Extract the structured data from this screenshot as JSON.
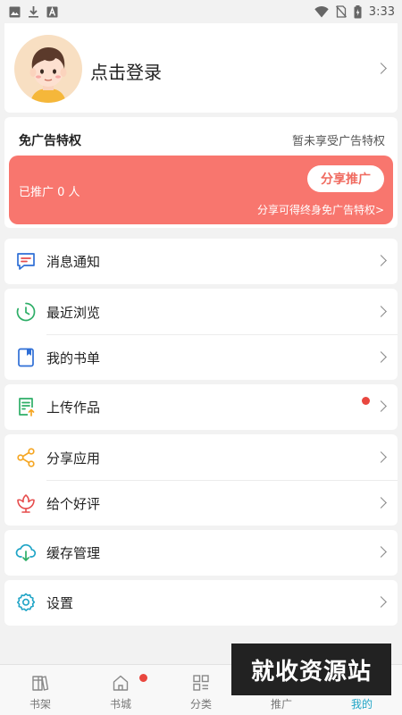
{
  "status_bar": {
    "time": "3:33",
    "icons": [
      "image-icon",
      "download-icon",
      "a-icon",
      "wifi-icon",
      "no-sim-icon",
      "battery-icon"
    ]
  },
  "profile": {
    "login_label": "点击登录"
  },
  "ad_privilege": {
    "title": "免广告特权",
    "status": "暂未享受广告特权",
    "promoted_count": "已推广 0 人",
    "share_button": "分享推广",
    "share_note": "分享可得终身免广告特权>"
  },
  "menu": {
    "messages": "消息通知",
    "recent": "最近浏览",
    "booklist": "我的书单",
    "upload": "上传作品",
    "share_app": "分享应用",
    "rate": "给个好评",
    "cache": "缓存管理",
    "settings": "设置"
  },
  "tabs": [
    {
      "label": "书架",
      "icon": "bookshelf-icon"
    },
    {
      "label": "书城",
      "icon": "home-icon",
      "badge": true
    },
    {
      "label": "分类",
      "icon": "grid-icon"
    },
    {
      "label": "推广",
      "icon": "promote-icon"
    },
    {
      "label": "我的",
      "icon": "profile-icon",
      "active": true
    }
  ],
  "watermark": "就收资源站",
  "colors": {
    "accent": "#1fa4c6",
    "promo_bg": "#f8766e",
    "badge_red": "#e9473f",
    "page_bg": "#f2f2f2"
  }
}
